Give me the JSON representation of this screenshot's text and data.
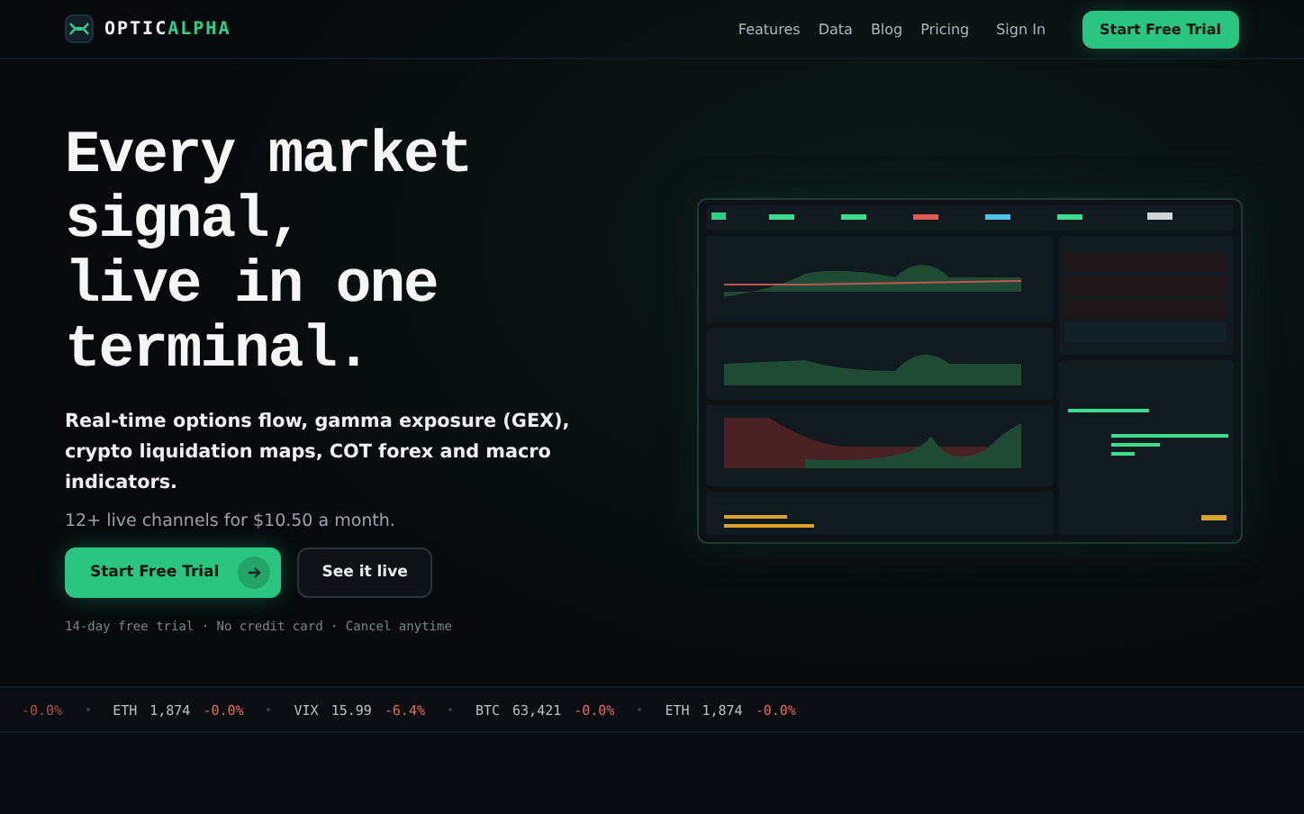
{
  "nav": {
    "brand": {
      "first": "OPTIC",
      "second": "ALPHA"
    },
    "links": [
      "Features",
      "Data",
      "Blog",
      "Pricing"
    ],
    "sign_in": "Sign In",
    "cta": "Start Free Trial"
  },
  "hero": {
    "headline_lines": [
      "Every market",
      "signal,",
      "live in one",
      "terminal."
    ],
    "subtitle": "Real-time options flow, gamma exposure (GEX), crypto liquidation maps, COT forex and macro indicators.",
    "price_note": "12+ live channels for $10.50 a month.",
    "primary_button": "Start Free Trial",
    "secondary_button": "See it live",
    "footnote": "14-day free trial · No credit card · Cancel anytime"
  },
  "ticker": [
    {
      "change": "-0.0%"
    },
    {
      "symbol": "ETH",
      "price": "1,874",
      "change": "-0.0%"
    },
    {
      "symbol": "VIX",
      "price": "15.99",
      "change": "-6.4%"
    },
    {
      "symbol": "BTC",
      "price": "63,421",
      "change": "-0.0%"
    },
    {
      "symbol": "ETH",
      "price": "1,874",
      "change": "-0.0%"
    }
  ]
}
